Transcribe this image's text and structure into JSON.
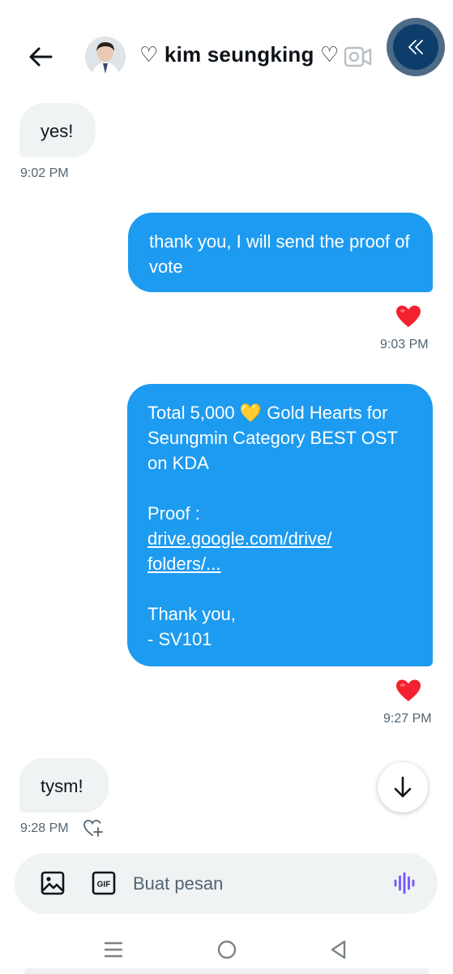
{
  "header": {
    "contact_name": "♡ kim seungking ♡",
    "icons": {
      "back": "arrow-left-icon",
      "video": "video-camera-icon",
      "collapse": "chevrons-left-icon"
    }
  },
  "messages": [
    {
      "direction": "received",
      "text": "yes!",
      "time": "9:02 PM"
    },
    {
      "direction": "sent",
      "text": "thank you, I will send the proof of vote",
      "time": "9:03 PM",
      "reaction": "❤️"
    },
    {
      "direction": "sent",
      "lines": {
        "l1": "Total 5,000 💛 Gold Hearts for",
        "l2": "Seungmin Category BEST OST",
        "l3": "on KDA",
        "l4": "Proof :",
        "link1": "drive.google.com/drive/",
        "link2": "folders/...",
        "l5": "Thank you,",
        "l6": "- SV101"
      },
      "time": "9:27 PM",
      "reaction": "❤️"
    },
    {
      "direction": "received",
      "text": "tysm!",
      "time": "9:28 PM"
    }
  ],
  "composer": {
    "placeholder": "Buat pesan",
    "gif_label": "GIF"
  },
  "colors": {
    "sent_bubble": "#1d9bf0",
    "received_bubble": "#eff3f4",
    "heart": "#f4212e",
    "voice": "#7856ff"
  }
}
